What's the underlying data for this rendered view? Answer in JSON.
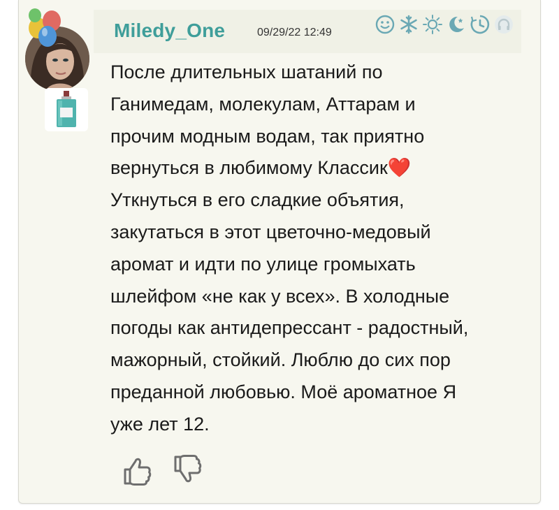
{
  "post": {
    "username": "Miledy_One",
    "timestamp": "09/29/22 12:49",
    "text": "После длительных шатаний по\nГанимедам, молекулам, Аттарам и\nпрочим модным водам, так приятно\nвернуться в любимому Классик❤️\nУткнуться в его сладкие объятия,\nзакутаться в этот цветочно-медовый\nаромат и идти по улице громыхать\nшлейфом «не как у всех». В холодные\nпогоды как антидепрессант - радостный,\nмажорный, стойкий. Люблю до сих пор\nпреданной любовью. Моё ароматное Я\nуже лет 12."
  },
  "status_icons": [
    "smile-icon",
    "snowflake-icon",
    "sun-icon",
    "night-moon-icon",
    "clock-icon",
    "headphones-icon"
  ],
  "votes": [
    "thumbs-up-icon",
    "thumbs-down-icon"
  ],
  "colors": {
    "username": "#3f9e9a",
    "card_background": "#f7f7ef",
    "header_background": "#f0f1e6",
    "icon_color": "#6aa8b4",
    "icon_inactive": "#b9c8cc"
  }
}
